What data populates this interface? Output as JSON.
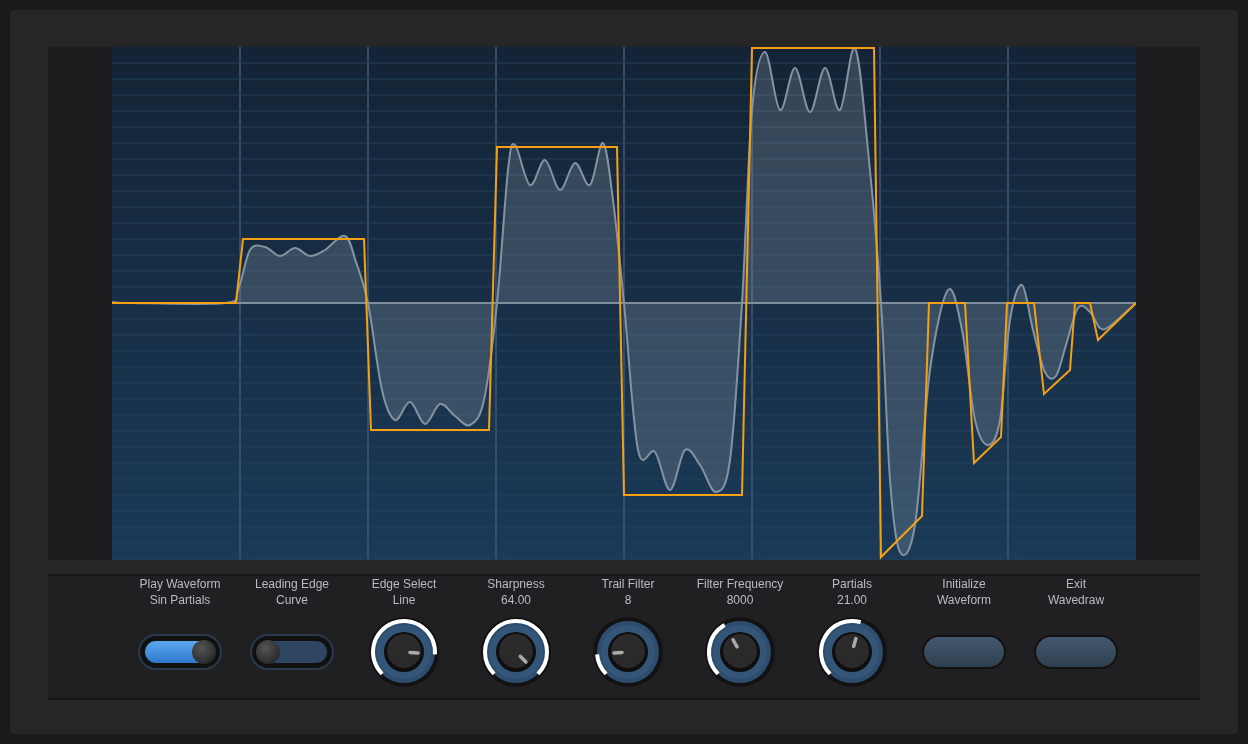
{
  "controls": [
    {
      "kind": "toggle",
      "label": "Play Waveform",
      "sublabel": "Sin Partials",
      "on": true
    },
    {
      "kind": "toggle",
      "label": "Leading Edge",
      "sublabel": "Curve",
      "on": false
    },
    {
      "kind": "knob",
      "label": "Edge Select",
      "sublabel": "Line"
    },
    {
      "kind": "knob",
      "label": "Sharpness",
      "sublabel": "64.00"
    },
    {
      "kind": "knob",
      "label": "Trail Filter",
      "sublabel": "8"
    },
    {
      "kind": "knob",
      "label": "Filter Frequency",
      "sublabel": "8000"
    },
    {
      "kind": "knob",
      "label": "Partials",
      "sublabel": "21.00"
    },
    {
      "kind": "button",
      "label": "Initialize",
      "sublabel": "Waveform"
    },
    {
      "kind": "button",
      "label": "Exit",
      "sublabel": "Wavedraw"
    }
  ]
}
